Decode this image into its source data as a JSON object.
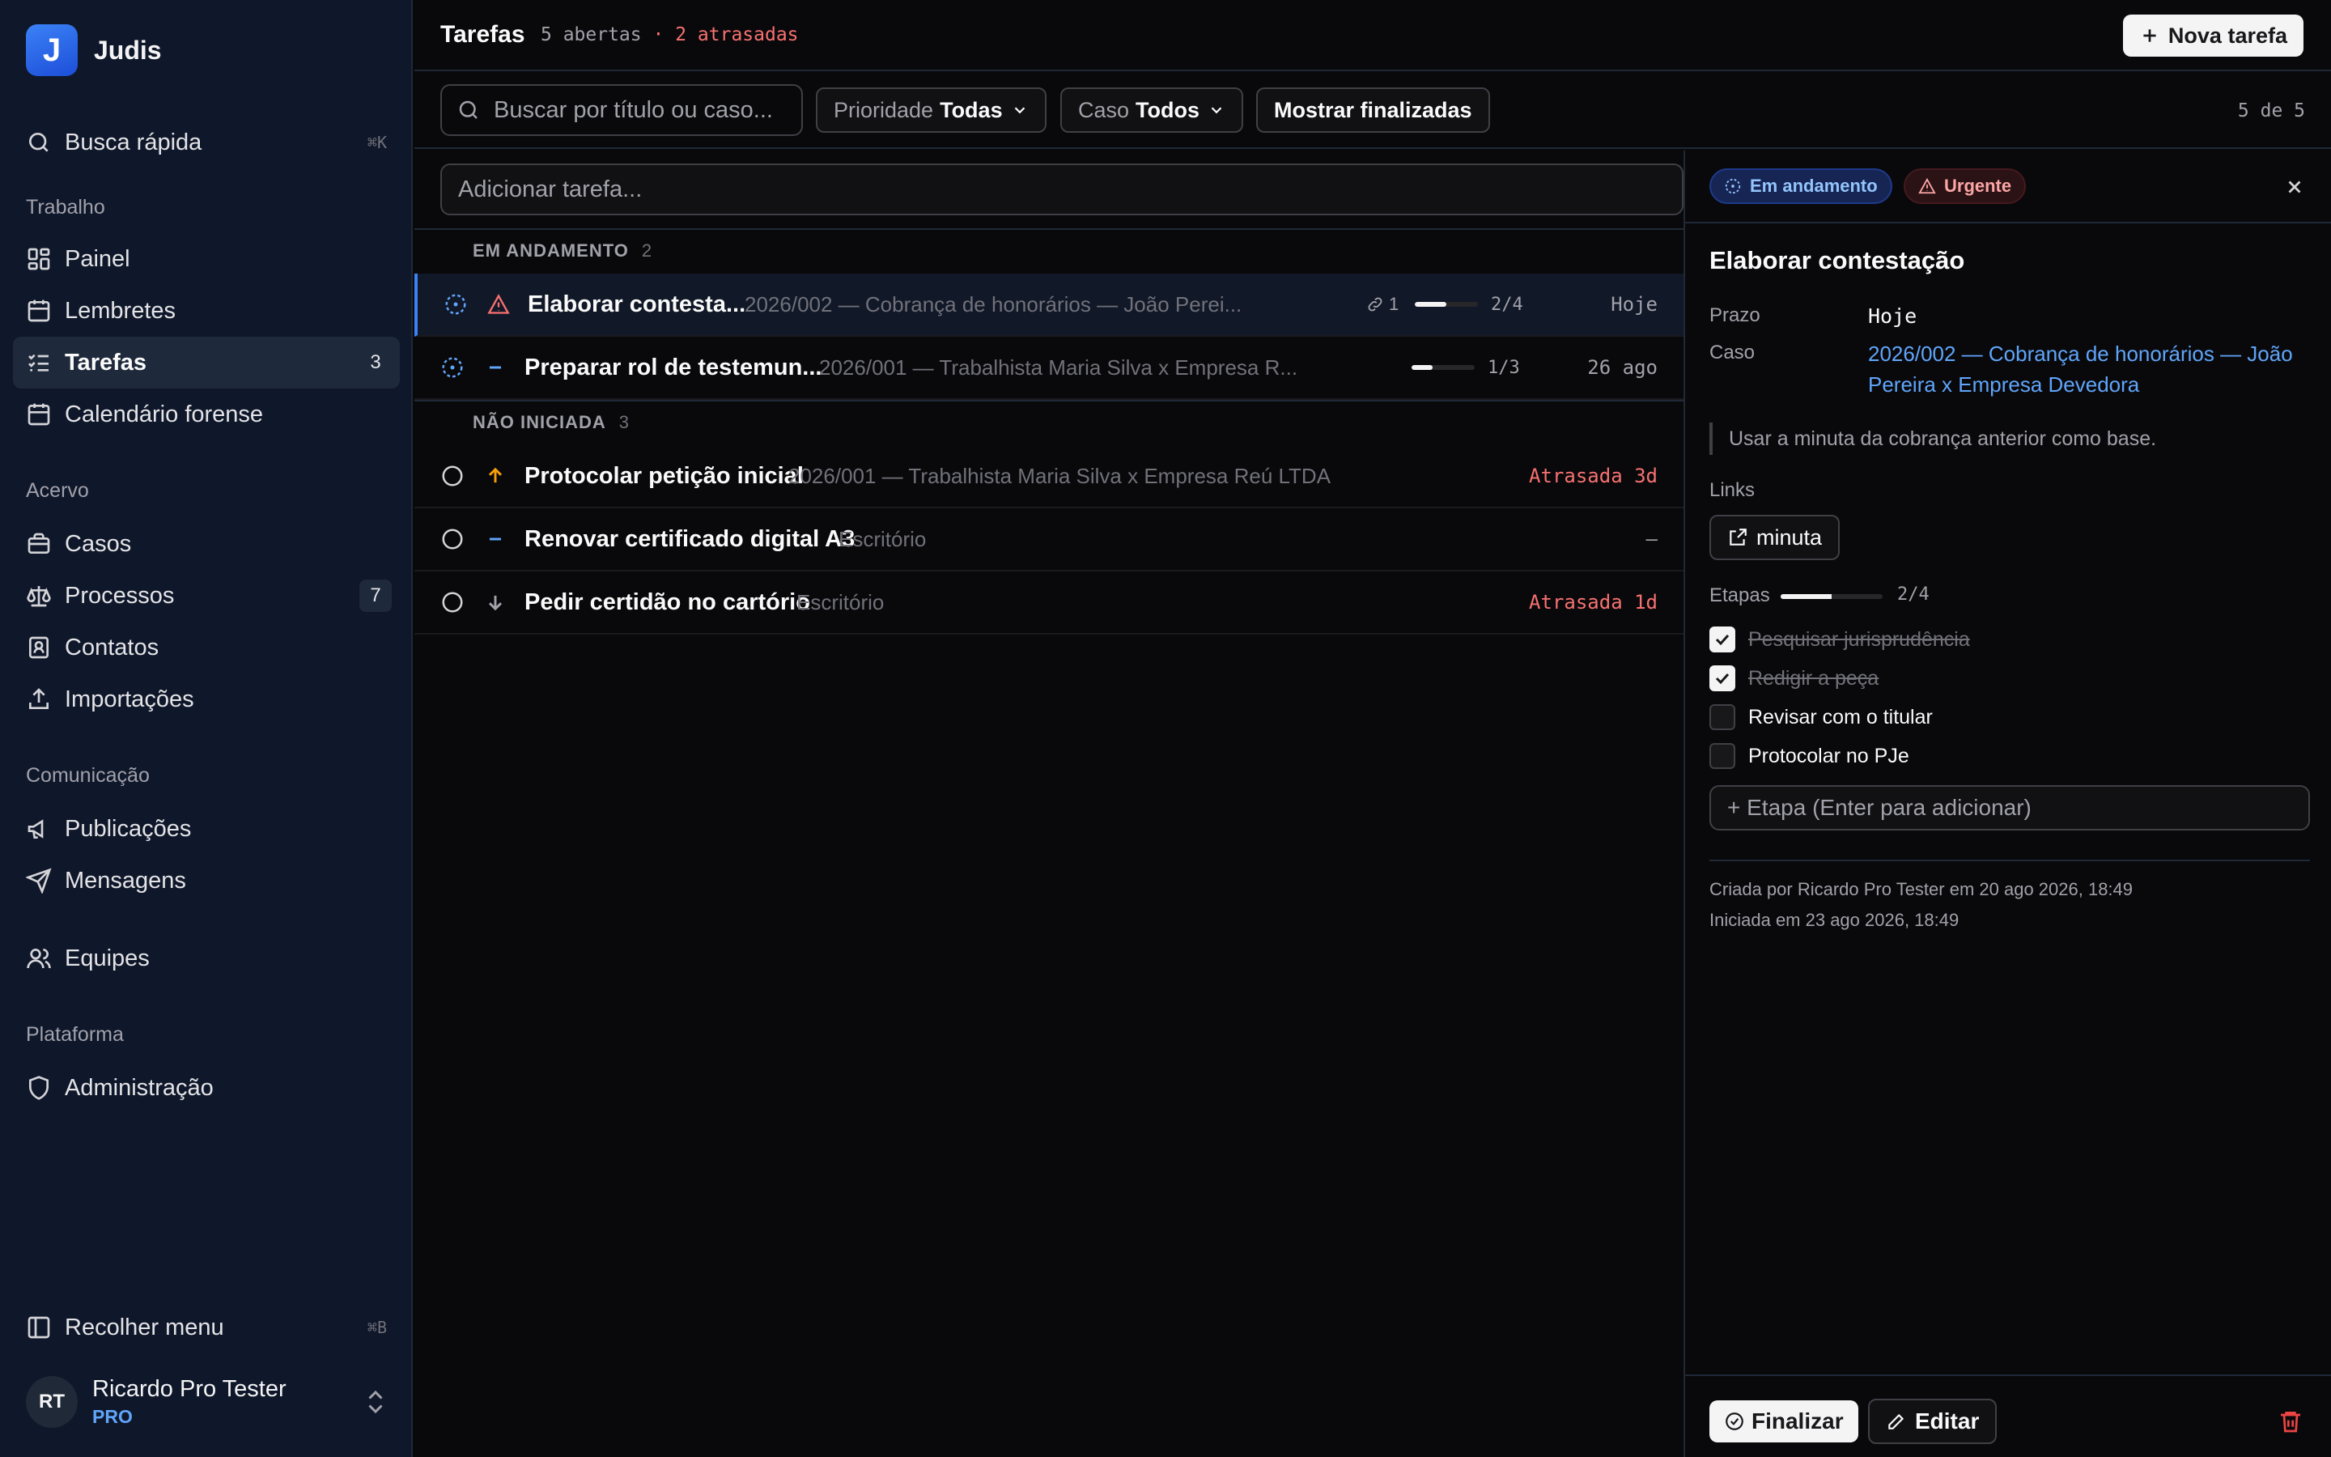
{
  "app": {
    "name": "Judis",
    "logo_letter": "J"
  },
  "sidebar": {
    "quick_search": {
      "label": "Busca rápida",
      "shortcut": "⌘K"
    },
    "sections": {
      "work": "Trabalho",
      "collection": "Acervo",
      "communication": "Comunicação",
      "platform": "Plataforma"
    },
    "items": {
      "painel": {
        "label": "Painel",
        "icon": "layout-dashboard-icon"
      },
      "lembretes": {
        "label": "Lembretes",
        "icon": "calendar-clock-icon"
      },
      "tarefas": {
        "label": "Tarefas",
        "icon": "list-checks-icon",
        "count": "3"
      },
      "calendario": {
        "label": "Calendário forense",
        "icon": "calendar-icon"
      },
      "casos": {
        "label": "Casos",
        "icon": "briefcase-icon"
      },
      "processos": {
        "label": "Processos",
        "icon": "scale-icon",
        "count": "7"
      },
      "contatos": {
        "label": "Contatos",
        "icon": "contact-icon"
      },
      "importacoes": {
        "label": "Importações",
        "icon": "upload-icon"
      },
      "publicacoes": {
        "label": "Publicações",
        "icon": "megaphone-icon"
      },
      "mensagens": {
        "label": "Mensagens",
        "icon": "send-icon"
      },
      "equipes": {
        "label": "Equipes",
        "icon": "users-icon"
      },
      "administracao": {
        "label": "Administração",
        "icon": "shield-icon"
      }
    },
    "collapse": {
      "label": "Recolher menu",
      "shortcut": "⌘B"
    },
    "user": {
      "initials": "RT",
      "name": "Ricardo Pro Tester",
      "plan": "PRO"
    }
  },
  "header": {
    "title": "Tarefas",
    "open_count": "5 abertas",
    "separator": "·",
    "late_count": "2 atrasadas",
    "new_task_label": "Nova tarefa"
  },
  "filters": {
    "search_placeholder": "Buscar por título ou caso...",
    "priority_key": "Prioridade",
    "priority_value": "Todas",
    "case_key": "Caso",
    "case_value": "Todos",
    "show_finished": "Mostrar finalizadas",
    "result_count": "5 de 5"
  },
  "add_task_placeholder": "Adicionar tarefa...",
  "groups": [
    {
      "title": "EM ANDAMENTO",
      "count": "2",
      "tasks": [
        {
          "title": "Elaborar contesta...",
          "case": "2026/002 — Cobrança de honorários — João Perei...",
          "links": "1",
          "progress": 0.5,
          "steps": "2/4",
          "due": "Hoje",
          "priority_icon": "alert-triangle-icon"
        },
        {
          "title": "Preparar rol de testemun...",
          "case": "2026/001 — Trabalhista Maria Silva x Empresa R...",
          "progress": 0.33,
          "steps": "1/3",
          "due": "26 ago",
          "priority_icon": "minus-icon"
        }
      ]
    },
    {
      "title": "NÃO INICIADA",
      "count": "3",
      "tasks": [
        {
          "title": "Protocolar petição inicial",
          "case": "2026/001 — Trabalhista Maria Silva x Empresa Reú LTDA",
          "due": "Atrasada 3d",
          "priority_icon": "arrow-up-icon"
        },
        {
          "title": "Renovar certificado digital A3",
          "case": "Escritório",
          "due": "–",
          "priority_icon": "minus-icon"
        },
        {
          "title": "Pedir certidão no cartório",
          "case": "Escritório",
          "due": "Atrasada 1d",
          "priority_icon": "arrow-down-icon"
        }
      ]
    }
  ],
  "detail": {
    "status_badge": "Em andamento",
    "priority_badge": "Urgente",
    "title": "Elaborar contestação",
    "due_label": "Prazo",
    "due_value": "Hoje",
    "case_label": "Caso",
    "case_value": "2026/002 — Cobrança de honorários — João Pereira x Empresa Devedora",
    "note": "Usar a minuta da cobrança anterior como base.",
    "links_label": "Links",
    "link_name": "minuta",
    "steps_label": "Etapas",
    "steps_progress": 0.5,
    "steps_count": "2/4",
    "steps": [
      {
        "label": "Pesquisar jurisprudência",
        "done": true
      },
      {
        "label": "Redigir a peça",
        "done": true
      },
      {
        "label": "Revisar com o titular",
        "done": false
      },
      {
        "label": "Protocolar no PJe",
        "done": false
      }
    ],
    "step_placeholder": "+ Etapa (Enter para adicionar)",
    "created": "Criada por Ricardo Pro Tester em 20 ago 2026, 18:49",
    "started": "Iniciada em 23 ago 2026, 18:49",
    "finish_label": "Finalizar",
    "edit_label": "Editar"
  },
  "colors": {
    "accent": "#3b82f6",
    "danger": "#f87171",
    "warning": "#f59e0b",
    "sidebar_bg": "#0f172a",
    "main_bg": "#09090b"
  }
}
